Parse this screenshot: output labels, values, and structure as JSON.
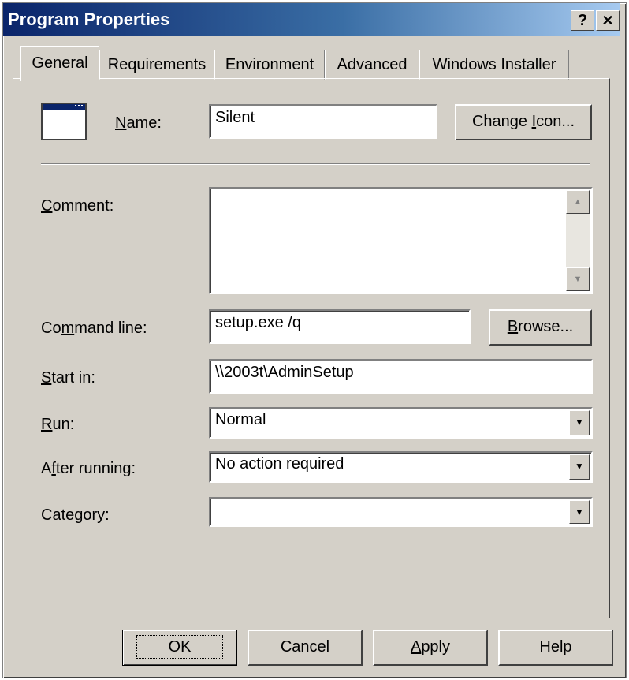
{
  "window": {
    "title": "Program Properties",
    "help_glyph": "?",
    "close_glyph": "✕"
  },
  "tabs": [
    {
      "label": "General",
      "active": true
    },
    {
      "label": "Requirements",
      "active": false
    },
    {
      "label": "Environment",
      "active": false
    },
    {
      "label": "Advanced",
      "active": false
    },
    {
      "label": "Windows Installer",
      "active": false
    }
  ],
  "general": {
    "name_label": {
      "pre": "",
      "key": "N",
      "post": "ame:"
    },
    "name_value": "Silent",
    "change_icon": {
      "pre": "Change ",
      "key": "I",
      "post": "con..."
    },
    "comment_label": {
      "pre": "",
      "key": "C",
      "post": "omment:"
    },
    "comment_value": "",
    "command_label": {
      "pre": "Co",
      "key": "m",
      "post": "mand line:"
    },
    "command_value": "setup.exe /q",
    "browse": {
      "pre": "",
      "key": "B",
      "post": "rowse..."
    },
    "startin_label": {
      "pre": "",
      "key": "S",
      "post": "tart in:"
    },
    "startin_value": "\\\\2003t\\AdminSetup",
    "run_label": {
      "pre": "",
      "key": "R",
      "post": "un:"
    },
    "run_value": "Normal",
    "after_label": {
      "pre": "A",
      "key": "f",
      "post": "ter running:"
    },
    "after_value": "No action required",
    "category_label": {
      "pre": "Cate",
      "key": "g",
      "post": "ory:"
    },
    "category_value": ""
  },
  "footer": {
    "ok": "OK",
    "cancel": "Cancel",
    "apply": {
      "pre": "",
      "key": "A",
      "post": "pply"
    },
    "help": "Help"
  },
  "icons": {
    "program": "program-window-icon",
    "dropdown": "chevron-down-icon",
    "scroll_up": "scroll-up-arrow-icon",
    "scroll_down": "scroll-down-arrow-icon"
  }
}
